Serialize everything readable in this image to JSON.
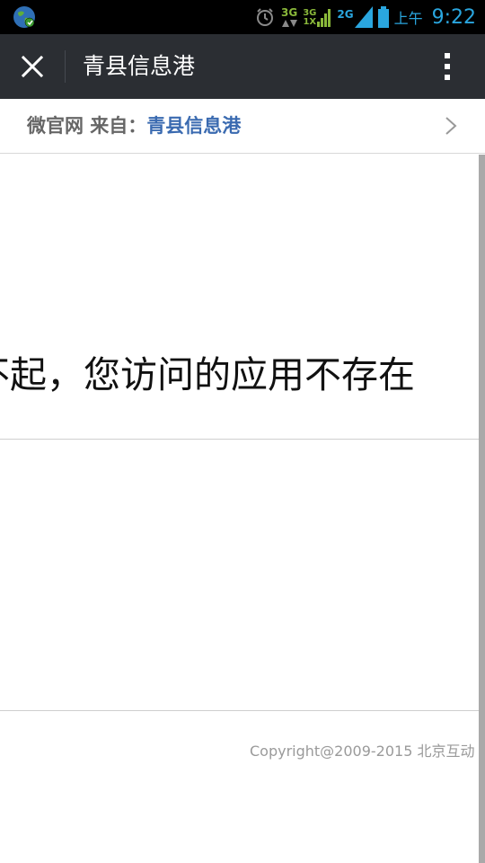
{
  "status_bar": {
    "network_a": "3G",
    "network_b_top": "3G",
    "network_b_bottom": "1X",
    "network_c": "2G",
    "ampm": "上午",
    "time": "9:22",
    "icons": [
      "globe-icon",
      "alarm-icon",
      "data-arrows-icon",
      "signal-icon",
      "battery-icon"
    ]
  },
  "title_bar": {
    "title": "青县信息港",
    "icons": [
      "close-icon",
      "more-vertical-icon"
    ]
  },
  "source_bar": {
    "prefix": "微官网 来自：",
    "source_name": "青县信息港",
    "icons": [
      "chevron-right-icon"
    ]
  },
  "content": {
    "error_message": "不起，您访问的应用不存在",
    "copyright": "Copyright@2009-2015 北京互动"
  },
  "colors": {
    "status_bar_bg": "#000000",
    "status_accent": "#2aa6df",
    "title_bar_bg": "#2b2e33",
    "link_blue": "#3a6ab0",
    "scrollbar": "#a9a9a9"
  }
}
